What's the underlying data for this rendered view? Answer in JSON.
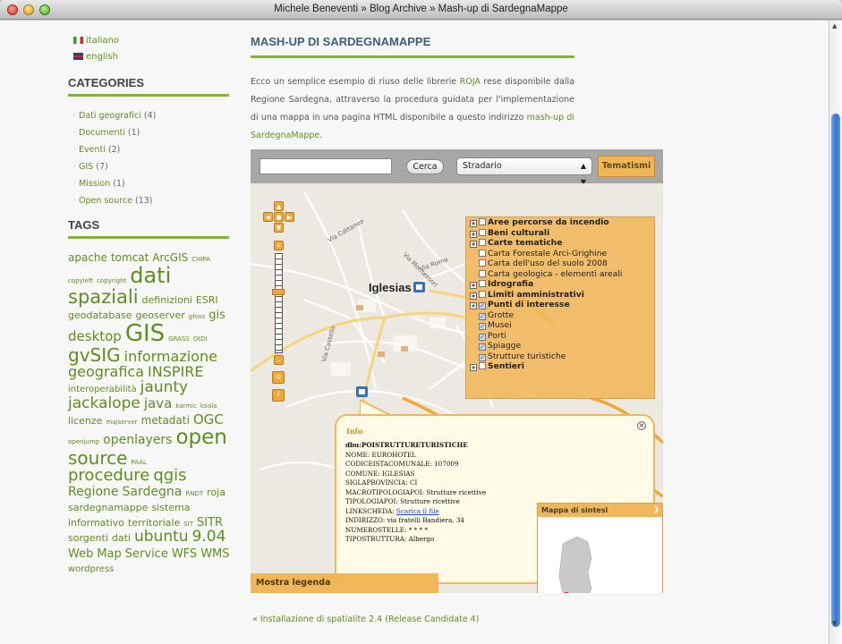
{
  "window": {
    "title": "Michele Beneventi » Blog Archive » Mash-up di SardegnaMappe"
  },
  "languages": [
    {
      "label": "italiano",
      "flag": "it"
    },
    {
      "label": "english",
      "flag": "uk"
    }
  ],
  "categories": {
    "heading": "CATEGORIES",
    "items": [
      {
        "label": "Dati geografici",
        "count": "(4)"
      },
      {
        "label": "Documenti",
        "count": "(1)"
      },
      {
        "label": "Eventi",
        "count": "(2)"
      },
      {
        "label": "GIS",
        "count": "(7)"
      },
      {
        "label": "Mission",
        "count": "(1)"
      },
      {
        "label": "Open source",
        "count": "(13)"
      }
    ]
  },
  "tags": {
    "heading": "TAGS",
    "items": [
      {
        "label": "apache",
        "size": 12
      },
      {
        "label": "tomcat",
        "size": 12
      },
      {
        "label": "ArcGIS",
        "size": 12
      },
      {
        "label": "CHIPA",
        "size": 7
      },
      {
        "label": "copyleft",
        "size": 7
      },
      {
        "label": "copyright",
        "size": 7
      },
      {
        "label": "dati",
        "size": 24
      },
      {
        "label": "spaziali",
        "size": 21
      },
      {
        "label": "definizioni",
        "size": 11
      },
      {
        "label": "ESRI",
        "size": 11
      },
      {
        "label": "geodatabase",
        "size": 11
      },
      {
        "label": "geoserver",
        "size": 11
      },
      {
        "label": "gfoss",
        "size": 7
      },
      {
        "label": "gis",
        "size": 13
      },
      {
        "label": "desktop",
        "size": 15
      },
      {
        "label": "GIS",
        "size": 26
      },
      {
        "label": "GRASS",
        "size": 7
      },
      {
        "label": "GtDI",
        "size": 7
      },
      {
        "label": "gvSIG",
        "size": 20
      },
      {
        "label": "informazione",
        "size": 16
      },
      {
        "label": "geografica",
        "size": 16
      },
      {
        "label": "INSPIRE",
        "size": 16
      },
      {
        "label": "interoperabilità",
        "size": 10
      },
      {
        "label": "jaunty",
        "size": 17
      },
      {
        "label": "jackalope",
        "size": 17
      },
      {
        "label": "java",
        "size": 15
      },
      {
        "label": "karmic",
        "size": 7
      },
      {
        "label": "koala",
        "size": 7
      },
      {
        "label": "licenze",
        "size": 11
      },
      {
        "label": "majserver",
        "size": 7
      },
      {
        "label": "metadati",
        "size": 12
      },
      {
        "label": "OGC",
        "size": 15
      },
      {
        "label": "openjump",
        "size": 7
      },
      {
        "label": "openlayers",
        "size": 14
      },
      {
        "label": "open",
        "size": 23
      },
      {
        "label": "source",
        "size": 20
      },
      {
        "label": "PAAL",
        "size": 7
      },
      {
        "label": "procedure",
        "size": 18
      },
      {
        "label": "qgis",
        "size": 18
      },
      {
        "label": "Regione",
        "size": 14
      },
      {
        "label": "Sardegna",
        "size": 14
      },
      {
        "label": "RNDT",
        "size": 7
      },
      {
        "label": "roja",
        "size": 11
      },
      {
        "label": "sardegnamappe",
        "size": 11
      },
      {
        "label": "sistema",
        "size": 11
      },
      {
        "label": "informativo",
        "size": 11
      },
      {
        "label": "territoriale",
        "size": 11
      },
      {
        "label": "SIT",
        "size": 7
      },
      {
        "label": "SITR",
        "size": 13
      },
      {
        "label": "sorgenti",
        "size": 11
      },
      {
        "label": "dati",
        "size": 11
      },
      {
        "label": "ubuntu",
        "size": 17
      },
      {
        "label": "9.04",
        "size": 17
      },
      {
        "label": "Web",
        "size": 13
      },
      {
        "label": "Map",
        "size": 13
      },
      {
        "label": "Service",
        "size": 13
      },
      {
        "label": "WFS",
        "size": 13
      },
      {
        "label": "WMS",
        "size": 13
      },
      {
        "label": "wordpress",
        "size": 10
      }
    ]
  },
  "post": {
    "title": "MASH-UP DI SARDEGNAMAPPE",
    "intro_1": "Ecco un semplice esempio di riuso delle librerie ",
    "intro_link_1": "ROJA",
    "intro_2": " rese disponibile dalla Regione Sardegna, attraverso la procedura guidata per l'implementazione di una mappa in una pagina HTML disponibile a questo indirizzo ",
    "intro_link_2": "mash-up di SardegnaMappe",
    "intro_3": ".",
    "prev_link": "« Installazione di spatialite 2.4 (Release Candidate 4)"
  },
  "map": {
    "search_placeholder": "",
    "search_button": "Cerca",
    "basemap_select": "Stradario",
    "tematismi_button": "Tematismi",
    "city_label": "Iglesias",
    "legend_button": "Mostra legenda",
    "minimap_title": "Mappa di sintesi",
    "layers": [
      {
        "label": "Aree percorse da incendio",
        "bold": true,
        "expand": true,
        "checked": false,
        "indent": false
      },
      {
        "label": "Beni culturali",
        "bold": true,
        "expand": true,
        "checked": false,
        "indent": false
      },
      {
        "label": "Carte tematiche",
        "bold": true,
        "expand": true,
        "checked": false,
        "indent": false
      },
      {
        "label": "Carta Forestale Arci-Grighine",
        "bold": false,
        "expand": false,
        "checked": false,
        "indent": true
      },
      {
        "label": "Carta dell'uso del suolo 2008",
        "bold": false,
        "expand": false,
        "checked": false,
        "indent": true
      },
      {
        "label": "Carta geologica - elementi areali",
        "bold": false,
        "expand": false,
        "checked": false,
        "indent": true
      },
      {
        "label": "Idrografia",
        "bold": true,
        "expand": true,
        "checked": false,
        "indent": false
      },
      {
        "label": "Limiti amministrativi",
        "bold": true,
        "expand": true,
        "checked": false,
        "indent": false
      },
      {
        "label": "Punti di interesse",
        "bold": true,
        "expand": true,
        "checked": true,
        "indent": false
      },
      {
        "label": "Grotte",
        "bold": false,
        "expand": false,
        "checked": true,
        "indent": true
      },
      {
        "label": "Musei",
        "bold": false,
        "expand": false,
        "checked": true,
        "indent": true
      },
      {
        "label": "Porti",
        "bold": false,
        "expand": false,
        "checked": true,
        "indent": true
      },
      {
        "label": "Spiagge",
        "bold": false,
        "expand": false,
        "checked": true,
        "indent": true
      },
      {
        "label": "Strutture turistiche",
        "bold": false,
        "expand": false,
        "checked": true,
        "indent": true
      },
      {
        "label": "Sentieri",
        "bold": true,
        "expand": true,
        "checked": false,
        "indent": false
      }
    ],
    "popup": {
      "title": "Info",
      "header": "dbu:POISTRUTTURETURISTICHE",
      "lines": [
        "NOME: EUROHOTEL",
        "CODICEISTACOMUNALE: 107009",
        "COMUNE: IGLESIAS",
        "SIGLAPROVINCIA: CI",
        "MACROTIPOLOGIAPOI: Strutture ricettive",
        "TIPOLOGIAPOI: Strutture ricettive"
      ],
      "link_label": "LINKSCHEDA: ",
      "link_text": "Scarica il file",
      "lines_after": [
        "INDIRIZZO: via fratelli Bandiera, 34",
        "NUMEROSTELLE: * * * *",
        "TIPOSTRUTTURA: Albergo"
      ]
    },
    "street_labels": [
      "Via Montessori",
      "Via Cattaneo",
      "Via Castello",
      "Via Roma"
    ]
  }
}
